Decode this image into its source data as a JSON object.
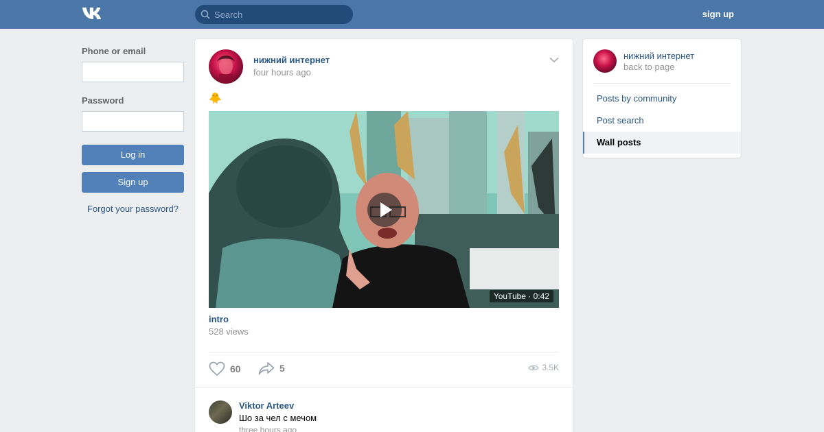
{
  "header": {
    "logo_icon": "vk-logo-icon",
    "search_placeholder": "Search",
    "signup_label": "sign up"
  },
  "login": {
    "phone_label": "Phone or email",
    "phone_value": "",
    "password_label": "Password",
    "password_value": "",
    "login_button": "Log in",
    "signup_button": "Sign up",
    "forgot_link": "Forgot your password?"
  },
  "post": {
    "author": "нижний интернет",
    "time": "four hours ago",
    "emoji": "🐥",
    "video": {
      "badge": "YouTube · 0:42",
      "title": "intro",
      "views": "528 views"
    },
    "likes": "60",
    "shares": "5",
    "views": "3.5K"
  },
  "comment": {
    "author": "Viktor Arteev",
    "text": "Шо за чел с мечом",
    "time": "three hours ago"
  },
  "sidebar": {
    "community_name": "нижний интернет",
    "back_label": "back to page",
    "items": [
      {
        "label": "Posts by community",
        "active": false
      },
      {
        "label": "Post search",
        "active": false
      },
      {
        "label": "Wall posts",
        "active": true
      }
    ]
  },
  "colors": {
    "topbar": "#4a76a8",
    "link": "#2a5885",
    "button": "#5181b8",
    "page_bg": "#edeef0"
  }
}
